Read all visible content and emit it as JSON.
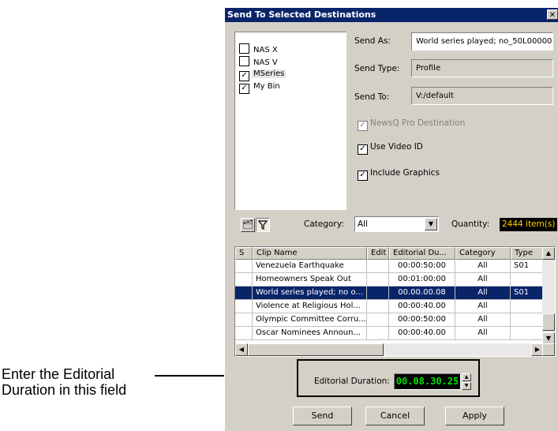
{
  "window": {
    "title": "Send To Selected Destinations",
    "close_glyph": "✕"
  },
  "destinations": [
    {
      "label": "NAS X",
      "checked": false
    },
    {
      "label": "NAS V",
      "checked": false
    },
    {
      "label": "MSeries",
      "checked": true,
      "selected": true
    },
    {
      "label": "My Bin",
      "checked": true
    }
  ],
  "form": {
    "send_as_label": "Send As:",
    "send_as_value": "World series played; no_50L00000",
    "send_type_label": "Send Type:",
    "send_type_value": "Profile",
    "send_to_label": "Send To:",
    "send_to_value": "V:/default"
  },
  "options": {
    "newsq": {
      "label": "NewsQ Pro Destination",
      "checked": true,
      "disabled": true
    },
    "use_video_id": {
      "label": "Use Video ID",
      "checked": true
    },
    "include_graphics": {
      "label": "Include Graphics",
      "checked": true
    }
  },
  "toolbar": {
    "category_label": "Category:",
    "category_value": "All",
    "quantity_label": "Quantity:",
    "quantity_value": "2444 item(s)"
  },
  "table": {
    "columns": [
      "S",
      "Clip Name",
      "Edit",
      "Editorial Du...",
      "Category",
      "Type"
    ],
    "rows": [
      {
        "s": "",
        "clip": "Venezuela Earthquake",
        "edit": "",
        "dur": "00:00:50:00",
        "cat": "All",
        "type": "S01",
        "selected": false
      },
      {
        "s": "",
        "clip": "Homeowners Speak Out",
        "edit": "",
        "dur": "00:01:00:00",
        "cat": "All",
        "type": "",
        "selected": false
      },
      {
        "s": "",
        "clip": "World series played; no o...",
        "edit": "",
        "dur": "00.00.00.08",
        "cat": "All",
        "type": "S01",
        "selected": true
      },
      {
        "s": "",
        "clip": "Violence at Religious Hol...",
        "edit": "",
        "dur": "00:00:40.00",
        "cat": "All",
        "type": "",
        "selected": false
      },
      {
        "s": "",
        "clip": "Olympic Committee Corru...",
        "edit": "",
        "dur": "00:00:50:00",
        "cat": "All",
        "type": "",
        "selected": false
      },
      {
        "s": "",
        "clip": "Oscar Nominees Announ...",
        "edit": "",
        "dur": "00:00:40.00",
        "cat": "All",
        "type": "",
        "selected": false
      }
    ]
  },
  "editorial": {
    "label": "Editorial Duration:",
    "value": "00.08.30.25"
  },
  "buttons": {
    "send": "Send",
    "cancel": "Cancel",
    "apply": "Apply"
  },
  "callout": {
    "line1": "Enter the Editorial",
    "line2": "Duration in this field"
  },
  "colors": {
    "titlebar": "#0a246a",
    "selection": "#0a246a",
    "quantity_text": "#ffd400",
    "duration_text": "#00e000"
  }
}
